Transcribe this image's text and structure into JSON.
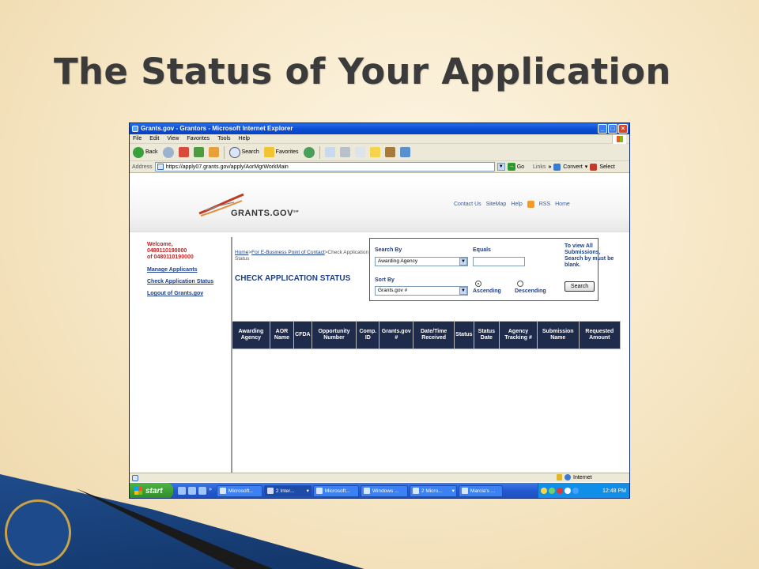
{
  "slide": {
    "title": "The Status of Your Application"
  },
  "window": {
    "title": "Grants.gov - Grantors - Microsoft Internet Explorer",
    "menu": [
      "File",
      "Edit",
      "View",
      "Favorites",
      "Tools",
      "Help"
    ],
    "toolbar": {
      "back": "Back",
      "search": "Search",
      "favorites": "Favorites"
    },
    "address": {
      "label": "Address",
      "url": "https://apply07.grants.gov/apply/AorMgrWorkMain",
      "go": "Go",
      "links": "Links",
      "convert": "Convert",
      "select": "Select"
    }
  },
  "site": {
    "logo": "GRANTS.GOV",
    "top_links": [
      "Contact Us",
      "SiteMap",
      "Help",
      "RSS",
      "Home"
    ],
    "welcome": [
      "Welcome,",
      "0480110190000",
      "of 0480110190000"
    ],
    "sidebar_links": [
      "Manage Applicants",
      "Check Application Status",
      "Logout of Grants.gov"
    ],
    "breadcrumb": {
      "home": "Home",
      "sep": ">",
      "poc": "For E-Business Point of Contact",
      "rest": ">Check Application Status"
    },
    "heading": "CHECK APPLICATION STATUS",
    "search": {
      "search_by_label": "Search By",
      "search_by_value": "Awarding Agency",
      "equals_label": "Equals",
      "equals_value": "",
      "sort_by_label": "Sort By",
      "sort_by_value": "Grants.gov #",
      "ascending": "Ascending",
      "descending": "Descending",
      "note": "To view All Submissions, Search by must be blank.",
      "button": "Search"
    },
    "columns": [
      "Awarding Agency",
      "AOR Name",
      "CFDA",
      "Opportunity Number",
      "Comp. ID",
      "Grants.gov #",
      "Date/Time Received",
      "Status",
      "Status Date",
      "Agency Tracking #",
      "Submission Name",
      "Requested Amount"
    ]
  },
  "statusbar": {
    "zone": "Internet"
  },
  "taskbar": {
    "start": "start",
    "tasks": [
      "Microsoft...",
      "2 Inter...",
      "Microsoft...",
      "Windows ...",
      "2 Micro...",
      "Marcia's ..."
    ],
    "clock": "12:48 PM"
  }
}
